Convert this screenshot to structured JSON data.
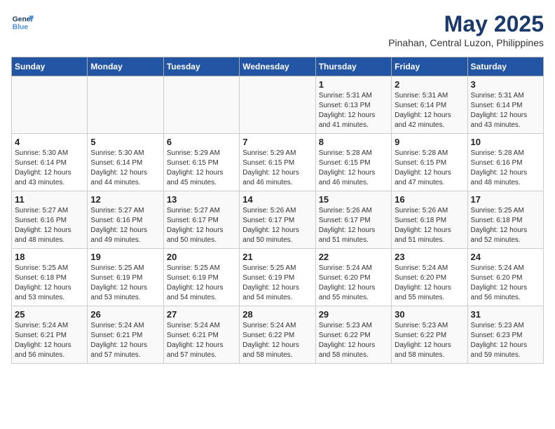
{
  "logo": {
    "line1": "General",
    "line2": "Blue"
  },
  "title": "May 2025",
  "subtitle": "Pinahan, Central Luzon, Philippines",
  "days_of_week": [
    "Sunday",
    "Monday",
    "Tuesday",
    "Wednesday",
    "Thursday",
    "Friday",
    "Saturday"
  ],
  "weeks": [
    [
      {
        "day": "",
        "info": ""
      },
      {
        "day": "",
        "info": ""
      },
      {
        "day": "",
        "info": ""
      },
      {
        "day": "",
        "info": ""
      },
      {
        "day": "1",
        "info": "Sunrise: 5:31 AM\nSunset: 6:13 PM\nDaylight: 12 hours\nand 41 minutes."
      },
      {
        "day": "2",
        "info": "Sunrise: 5:31 AM\nSunset: 6:14 PM\nDaylight: 12 hours\nand 42 minutes."
      },
      {
        "day": "3",
        "info": "Sunrise: 5:31 AM\nSunset: 6:14 PM\nDaylight: 12 hours\nand 43 minutes."
      }
    ],
    [
      {
        "day": "4",
        "info": "Sunrise: 5:30 AM\nSunset: 6:14 PM\nDaylight: 12 hours\nand 43 minutes."
      },
      {
        "day": "5",
        "info": "Sunrise: 5:30 AM\nSunset: 6:14 PM\nDaylight: 12 hours\nand 44 minutes."
      },
      {
        "day": "6",
        "info": "Sunrise: 5:29 AM\nSunset: 6:15 PM\nDaylight: 12 hours\nand 45 minutes."
      },
      {
        "day": "7",
        "info": "Sunrise: 5:29 AM\nSunset: 6:15 PM\nDaylight: 12 hours\nand 46 minutes."
      },
      {
        "day": "8",
        "info": "Sunrise: 5:28 AM\nSunset: 6:15 PM\nDaylight: 12 hours\nand 46 minutes."
      },
      {
        "day": "9",
        "info": "Sunrise: 5:28 AM\nSunset: 6:15 PM\nDaylight: 12 hours\nand 47 minutes."
      },
      {
        "day": "10",
        "info": "Sunrise: 5:28 AM\nSunset: 6:16 PM\nDaylight: 12 hours\nand 48 minutes."
      }
    ],
    [
      {
        "day": "11",
        "info": "Sunrise: 5:27 AM\nSunset: 6:16 PM\nDaylight: 12 hours\nand 48 minutes."
      },
      {
        "day": "12",
        "info": "Sunrise: 5:27 AM\nSunset: 6:16 PM\nDaylight: 12 hours\nand 49 minutes."
      },
      {
        "day": "13",
        "info": "Sunrise: 5:27 AM\nSunset: 6:17 PM\nDaylight: 12 hours\nand 50 minutes."
      },
      {
        "day": "14",
        "info": "Sunrise: 5:26 AM\nSunset: 6:17 PM\nDaylight: 12 hours\nand 50 minutes."
      },
      {
        "day": "15",
        "info": "Sunrise: 5:26 AM\nSunset: 6:17 PM\nDaylight: 12 hours\nand 51 minutes."
      },
      {
        "day": "16",
        "info": "Sunrise: 5:26 AM\nSunset: 6:18 PM\nDaylight: 12 hours\nand 51 minutes."
      },
      {
        "day": "17",
        "info": "Sunrise: 5:25 AM\nSunset: 6:18 PM\nDaylight: 12 hours\nand 52 minutes."
      }
    ],
    [
      {
        "day": "18",
        "info": "Sunrise: 5:25 AM\nSunset: 6:18 PM\nDaylight: 12 hours\nand 53 minutes."
      },
      {
        "day": "19",
        "info": "Sunrise: 5:25 AM\nSunset: 6:19 PM\nDaylight: 12 hours\nand 53 minutes."
      },
      {
        "day": "20",
        "info": "Sunrise: 5:25 AM\nSunset: 6:19 PM\nDaylight: 12 hours\nand 54 minutes."
      },
      {
        "day": "21",
        "info": "Sunrise: 5:25 AM\nSunset: 6:19 PM\nDaylight: 12 hours\nand 54 minutes."
      },
      {
        "day": "22",
        "info": "Sunrise: 5:24 AM\nSunset: 6:20 PM\nDaylight: 12 hours\nand 55 minutes."
      },
      {
        "day": "23",
        "info": "Sunrise: 5:24 AM\nSunset: 6:20 PM\nDaylight: 12 hours\nand 55 minutes."
      },
      {
        "day": "24",
        "info": "Sunrise: 5:24 AM\nSunset: 6:20 PM\nDaylight: 12 hours\nand 56 minutes."
      }
    ],
    [
      {
        "day": "25",
        "info": "Sunrise: 5:24 AM\nSunset: 6:21 PM\nDaylight: 12 hours\nand 56 minutes."
      },
      {
        "day": "26",
        "info": "Sunrise: 5:24 AM\nSunset: 6:21 PM\nDaylight: 12 hours\nand 57 minutes."
      },
      {
        "day": "27",
        "info": "Sunrise: 5:24 AM\nSunset: 6:21 PM\nDaylight: 12 hours\nand 57 minutes."
      },
      {
        "day": "28",
        "info": "Sunrise: 5:24 AM\nSunset: 6:22 PM\nDaylight: 12 hours\nand 58 minutes."
      },
      {
        "day": "29",
        "info": "Sunrise: 5:23 AM\nSunset: 6:22 PM\nDaylight: 12 hours\nand 58 minutes."
      },
      {
        "day": "30",
        "info": "Sunrise: 5:23 AM\nSunset: 6:22 PM\nDaylight: 12 hours\nand 58 minutes."
      },
      {
        "day": "31",
        "info": "Sunrise: 5:23 AM\nSunset: 6:23 PM\nDaylight: 12 hours\nand 59 minutes."
      }
    ]
  ]
}
